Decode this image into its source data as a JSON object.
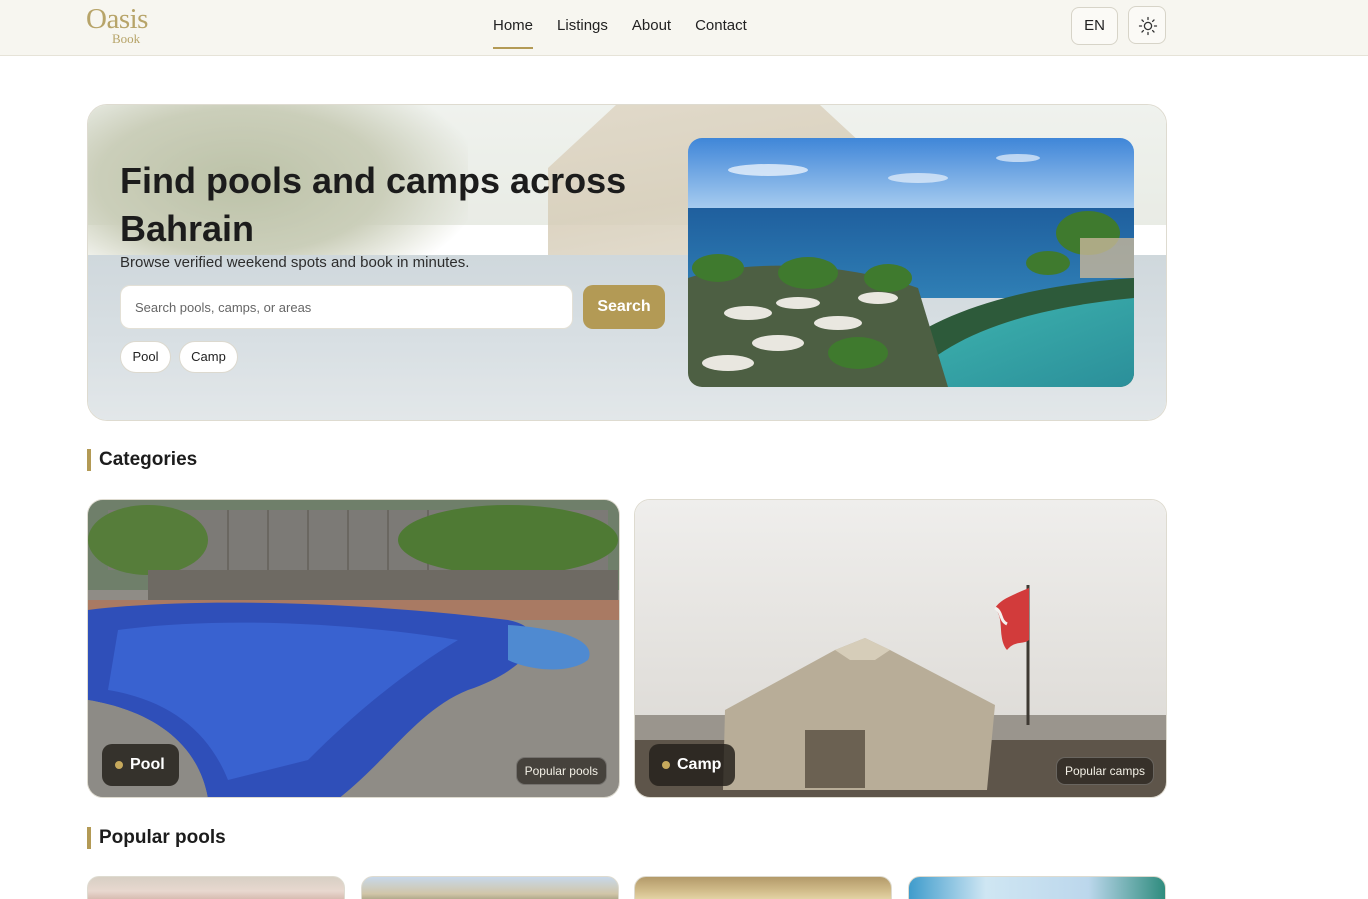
{
  "header": {
    "logo_main": "Oasis",
    "logo_sub": "Book",
    "nav": [
      {
        "label": "Home",
        "active": true
      },
      {
        "label": "Listings",
        "active": false
      },
      {
        "label": "About",
        "active": false
      },
      {
        "label": "Contact",
        "active": false
      }
    ],
    "language": "EN",
    "theme_icon": "sun-icon"
  },
  "hero": {
    "title": "Find pools and camps across Bahrain",
    "subtitle": "Browse verified weekend spots and book in minutes.",
    "search_placeholder": "Search pools, camps, or areas",
    "search_value": "",
    "search_button": "Search",
    "chips": [
      "Pool",
      "Camp"
    ]
  },
  "categories": {
    "title": "Categories",
    "items": [
      {
        "label": "Pool",
        "tag": "Popular pools"
      },
      {
        "label": "Camp",
        "tag": "Popular camps"
      }
    ]
  },
  "popular": {
    "title": "Popular pools"
  },
  "colors": {
    "accent": "#b39a55",
    "header_bg": "#f7f6f0",
    "logo": "#b7a469",
    "badge_bg": "#26221c"
  }
}
